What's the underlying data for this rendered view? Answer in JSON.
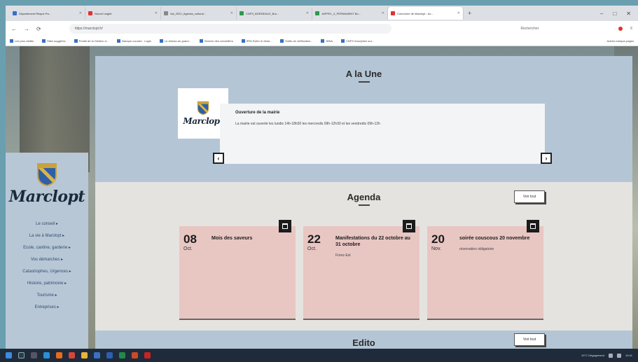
{
  "browser": {
    "tabs": [
      {
        "label": "Département Risque Pa...",
        "color": "#3a6fc4"
      },
      {
        "label": "Nouvel onglet",
        "color": "#d33"
      },
      {
        "label": "Val_2022_Agenda_cultural...",
        "color": "#888"
      },
      {
        "label": "CNFS_BORDEAUX_Bur...",
        "color": "#2d9a4c"
      },
      {
        "label": "JAPPEL_4_PERMANENT Bo...",
        "color": "#2d9a4c"
      },
      {
        "label": "Commune de Marclopt - Ac...",
        "color": "#d33"
      }
    ],
    "new_tab": "+",
    "window_controls": [
      "–",
      "□",
      "✕"
    ],
    "nav_buttons": [
      "←",
      "→",
      "⟳"
    ],
    "url": "https://marclopt.fr/",
    "search_placeholder": "Rechercher",
    "bookmarks": [
      "Les plus visités",
      "Sites suggérés",
      "Portail de la Gestion d...",
      "Banque courant - Login",
      "Le réseau au grand...",
      "Service des conseillers",
      "IRIS Eviter le délai...",
      "Outils de vérification...",
      "NINA",
      "CNFS Inscription sur...",
      "Autres marque-pages"
    ]
  },
  "sidebar": {
    "logo_text": "Marclopt",
    "menu": [
      "Le conseil ▸",
      "La vie à Marclopt ▸",
      "Ecole, cantine, garderie ▸",
      "Vos démarches ▸",
      "Catastrophes, Urgences ▸",
      "Histoire, patrimoine ▸",
      "Tourisme ▸",
      "Entreprises ▸"
    ]
  },
  "une": {
    "title": "A la Une",
    "logo_text": "Marclopt",
    "news_title": "Ouverture de la mairie",
    "news_text": "La mairie est ouverte les lundis 14h-18h30 les mercredis 09h-12h30 et les vendredis 09h-12h",
    "prev": "‹",
    "next": "›"
  },
  "agenda": {
    "title": "Agenda",
    "voir_tout": "Voir tout",
    "events": [
      {
        "day": "08",
        "month": "Oct.",
        "title": "Mois des saveurs",
        "desc": ""
      },
      {
        "day": "22",
        "month": "Oct.",
        "title": "Manifestations du 22 octobre au 31 octobre",
        "desc": "Forez-Est"
      },
      {
        "day": "20",
        "month": "Nov.",
        "title": "soirée couscous 20 novembre",
        "desc": "réservation obligatoire"
      }
    ]
  },
  "edito": {
    "title": "Edito",
    "voir_tout": "Voir tout"
  },
  "taskbar": {
    "weather": "10°C Dégagement",
    "time": "10:41"
  },
  "colors": {
    "header_band": "#b4c6d6",
    "event_card": "#e8c6c2",
    "sidebar": "#b8c7d6"
  }
}
